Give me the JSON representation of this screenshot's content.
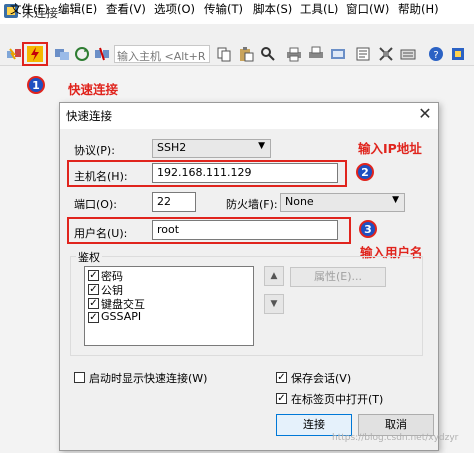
{
  "window": {
    "title": "未连接 -"
  },
  "menu": [
    "文件(F)",
    "编辑(E)",
    "查看(V)",
    "选项(O)",
    "传输(T)",
    "脚本(S)",
    "工具(L)",
    "窗口(W)",
    "帮助(H)"
  ],
  "toolbar": {
    "quick_connect_icon": "lightning-connect-icon",
    "host_input_placeholder": "输入主机 <Alt+R"
  },
  "annotations": {
    "badge1": "1",
    "badge2": "2",
    "badge3": "3",
    "quick_connect": "快速连接",
    "enter_ip": "输入IP地址",
    "enter_user": "输入用户名"
  },
  "dialog": {
    "title": "快速连接",
    "protocol_label": "协议(P):",
    "protocol_value": "SSH2",
    "hostname_label": "主机名(H):",
    "hostname_value": "192.168.111.129",
    "port_label": "端口(O):",
    "port_value": "22",
    "firewall_label": "防火墙(F):",
    "firewall_value": "None",
    "username_label": "用户名(U):",
    "username_value": "root",
    "auth_legend": "鉴权",
    "auth_methods": [
      {
        "label": "密码",
        "checked": true
      },
      {
        "label": "公钥",
        "checked": true
      },
      {
        "label": "键盘交互",
        "checked": true
      },
      {
        "label": "GSSAPI",
        "checked": true
      }
    ],
    "properties_button": "属性(E)...",
    "show_on_startup": {
      "label": "启动时显示快速连接(W)",
      "checked": false
    },
    "save_session": {
      "label": "保存会话(V)",
      "checked": true
    },
    "open_in_tab": {
      "label": "在标签页中打开(T)",
      "checked": true
    },
    "connect_button": "连接",
    "cancel_button": "取消"
  },
  "watermark": "https://blog.csdn.net/xydzyr"
}
